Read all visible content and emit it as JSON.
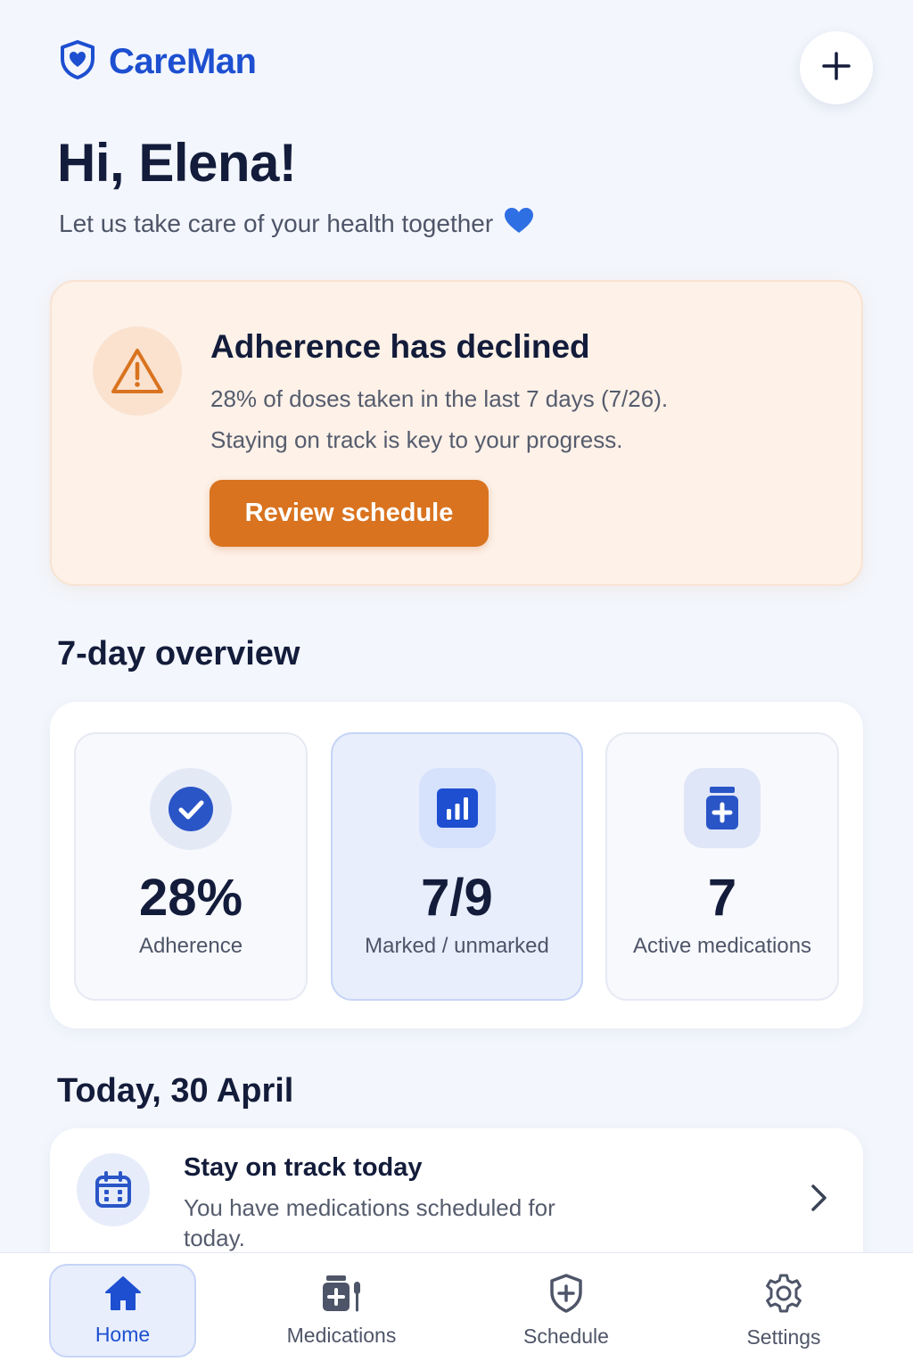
{
  "header": {
    "app_name": "CareMan",
    "logo_icon": "shield-heart-icon",
    "add_button_icon": "plus-icon"
  },
  "greeting": {
    "title": "Hi, Elena!",
    "tagline": "Let us take care of your health together",
    "tagline_icon": "blue-heart-icon"
  },
  "alert": {
    "icon": "warning-triangle-icon",
    "title": "Adherence has declined",
    "line1": "28% of doses taken in the last 7 days (7/26).",
    "line2": "Staying on track is key to your progress.",
    "button_label": "Review schedule",
    "accent_color": "#d9731f"
  },
  "overview": {
    "title": "7-day overview",
    "stats": [
      {
        "icon": "check-circle-icon",
        "value": "28%",
        "label": "Adherence"
      },
      {
        "icon": "bar-chart-icon",
        "value": "7/9",
        "label": "Marked / unmarked"
      },
      {
        "icon": "medicine-bottle-icon",
        "value": "7",
        "label": "Active medications"
      }
    ]
  },
  "today": {
    "title": "Today, 30 April",
    "card": {
      "icon": "calendar-icon",
      "heading": "Stay on track today",
      "subtitle": "You have medications scheduled for today.",
      "chevron_icon": "chevron-right-icon"
    }
  },
  "nav": {
    "items": [
      {
        "label": "Home",
        "icon": "home-icon",
        "active": true
      },
      {
        "label": "Medications",
        "icon": "medications-icon",
        "active": false
      },
      {
        "label": "Schedule",
        "icon": "shield-plus-icon",
        "active": false
      },
      {
        "label": "Settings",
        "icon": "gear-icon",
        "active": false
      }
    ]
  },
  "colors": {
    "brand": "#1d4fd0",
    "background": "#f3f6fc",
    "alert_background": "#fdf1e8"
  }
}
